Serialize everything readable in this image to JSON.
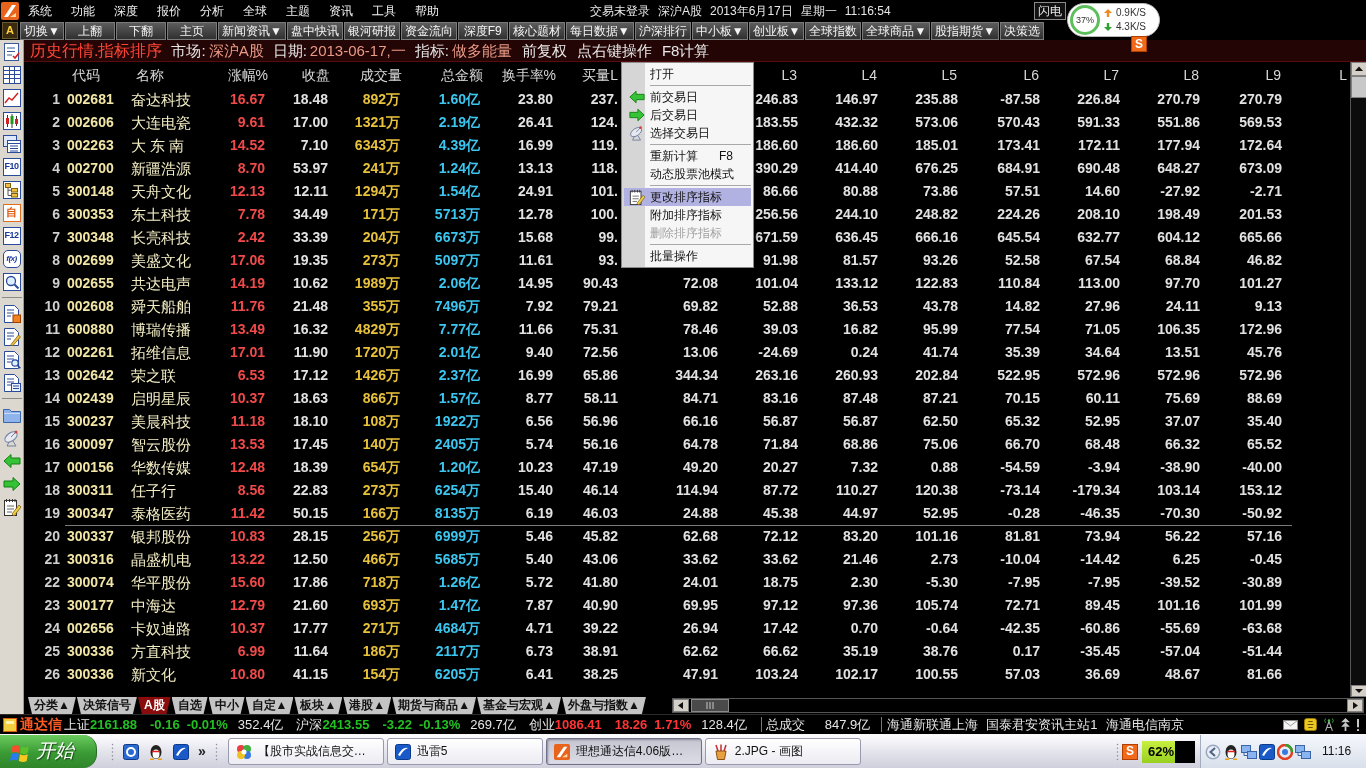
{
  "menu_bar": {
    "items": [
      "系统",
      "功能",
      "深度",
      "报价",
      "分析",
      "全球",
      "主题",
      "资讯",
      "工具",
      "帮助"
    ],
    "login_status": "交易未登录",
    "market": "深沪A股",
    "date": "2013年6月17日",
    "weekday": "星期一",
    "time": "11:16:54",
    "flash_button": "闪电"
  },
  "speed_widget": {
    "usage": "37%",
    "upload": "0.9K/S",
    "download": "4.3K/S"
  },
  "ime_toolbar": {
    "logo": "S"
  },
  "toolbar": {
    "lead": "A",
    "buttons": [
      "切换▼",
      "上翻",
      "下翻",
      "主页",
      "新闻资讯▼",
      "盘中快讯",
      "银河研报",
      "资金流向",
      "深度F9",
      "核心题材",
      "每日数据▼",
      "沪深排行",
      "中小板▼",
      "创业板▼",
      "全球指数",
      "全球商品▼",
      "股指期货▼",
      "决策选"
    ]
  },
  "sidebar": {
    "text_icons": [
      "F10",
      "自",
      "F12",
      "f(x)"
    ]
  },
  "title_bar": {
    "title": "历史行情.指标排序",
    "fields": [
      {
        "label": "市场:",
        "value": "深沪A股"
      },
      {
        "label": "日期:",
        "value": "2013-06-17,一"
      },
      {
        "label": "指标:",
        "value": "做多能量"
      }
    ],
    "notes": [
      "前复权",
      "点右键操作",
      "F8计算"
    ]
  },
  "table": {
    "columns": [
      null,
      "代码",
      "名称",
      "涨幅%",
      "收盘",
      "成交量",
      "总金额",
      "换手率%",
      "买量L",
      null,
      "L3",
      "L4",
      "L5",
      "L6",
      "L7",
      "L8",
      "L9",
      "L"
    ],
    "row_groups": [
      [
        {
          "cells": [
            "1",
            "002681",
            "奋达科技",
            "16.67",
            "18.48",
            "892万",
            "1.60亿",
            "23.80",
            "237.",
            null,
            "246.83",
            "146.97",
            "235.88",
            "-87.58",
            "226.84",
            "270.79",
            "270.79",
            null
          ]
        },
        {
          "cells": [
            "2",
            "002606",
            "大连电瓷",
            "9.61",
            "17.00",
            "1321万",
            "2.19亿",
            "26.41",
            "124.",
            null,
            "183.55",
            "432.32",
            "573.06",
            "570.43",
            "591.33",
            "551.86",
            "569.53",
            null
          ]
        },
        {
          "cells": [
            "3",
            "002263",
            "大 东 南",
            "14.52",
            "7.10",
            "6343万",
            "4.39亿",
            "16.99",
            "119.",
            null,
            "186.60",
            "186.60",
            "185.01",
            "173.41",
            "172.11",
            "177.94",
            "172.64",
            null
          ]
        },
        {
          "cells": [
            "4",
            "002700",
            "新疆浩源",
            "8.70",
            "53.97",
            "241万",
            "1.24亿",
            "13.13",
            "118.",
            null,
            "390.29",
            "414.40",
            "676.25",
            "684.91",
            "690.48",
            "648.27",
            "673.09",
            null
          ]
        },
        {
          "cells": [
            "5",
            "300148",
            "天舟文化",
            "12.13",
            "12.11",
            "1294万",
            "1.54亿",
            "24.91",
            "101.",
            null,
            "86.66",
            "80.88",
            "73.86",
            "57.51",
            "14.60",
            "-27.92",
            "-2.71",
            null
          ]
        },
        {
          "cells": [
            "6",
            "300353",
            "东土科技",
            "7.78",
            "34.49",
            "171万",
            "5713万",
            "12.78",
            "100.",
            null,
            "256.56",
            "244.10",
            "248.82",
            "224.26",
            "208.10",
            "198.49",
            "201.53",
            null
          ]
        },
        {
          "cells": [
            "7",
            "300348",
            "长亮科技",
            "2.42",
            "33.39",
            "204万",
            "6673万",
            "15.68",
            "99.",
            null,
            "671.59",
            "636.45",
            "666.16",
            "645.54",
            "632.77",
            "604.12",
            "665.66",
            null
          ]
        },
        {
          "cells": [
            "8",
            "002699",
            "美盛文化",
            "17.06",
            "19.35",
            "273万",
            "5097万",
            "11.61",
            "93.",
            null,
            "91.98",
            "81.57",
            "93.26",
            "52.58",
            "67.54",
            "68.84",
            "46.82",
            null
          ]
        },
        {
          "cells": [
            "9",
            "002655",
            "共达电声",
            "14.19",
            "10.62",
            "1989万",
            "2.06亿",
            "14.95",
            "90.43",
            "72.08",
            "101.04",
            "133.12",
            "122.83",
            "110.84",
            "113.00",
            "97.70",
            "101.27",
            null
          ]
        },
        {
          "cells": [
            "10",
            "002608",
            "舜天船舶",
            "11.76",
            "21.48",
            "355万",
            "7496万",
            "7.92",
            "79.21",
            "69.82",
            "52.88",
            "36.53",
            "43.78",
            "14.82",
            "27.96",
            "24.11",
            "9.13",
            null
          ]
        },
        {
          "cells": [
            "11",
            "600880",
            "博瑞传播",
            "13.49",
            "16.32",
            "4829万",
            "7.77亿",
            "11.66",
            "75.31",
            "78.46",
            "39.03",
            "16.82",
            "95.99",
            "77.54",
            "71.05",
            "106.35",
            "172.96",
            null
          ]
        },
        {
          "cells": [
            "12",
            "002261",
            "拓维信息",
            "17.01",
            "11.90",
            "1720万",
            "2.01亿",
            "9.40",
            "72.56",
            "13.06",
            "-24.69",
            "0.24",
            "41.74",
            "35.39",
            "34.64",
            "13.51",
            "45.76",
            null
          ]
        },
        {
          "cells": [
            "13",
            "002642",
            "荣之联",
            "6.53",
            "17.12",
            "1426万",
            "2.37亿",
            "16.99",
            "65.86",
            "344.34",
            "263.16",
            "260.93",
            "202.84",
            "522.95",
            "572.96",
            "572.96",
            "572.96",
            null
          ]
        },
        {
          "cells": [
            "14",
            "002439",
            "启明星辰",
            "10.37",
            "18.63",
            "866万",
            "1.57亿",
            "8.77",
            "58.11",
            "84.71",
            "83.16",
            "87.48",
            "87.21",
            "70.15",
            "60.11",
            "75.69",
            "88.69",
            null
          ]
        },
        {
          "cells": [
            "15",
            "300237",
            "美晨科技",
            "11.18",
            "18.10",
            "108万",
            "1922万",
            "6.56",
            "56.96",
            "66.16",
            "56.87",
            "56.87",
            "62.50",
            "65.32",
            "52.95",
            "37.07",
            "35.40",
            null
          ]
        },
        {
          "cells": [
            "16",
            "300097",
            "智云股份",
            "13.53",
            "17.45",
            "140万",
            "2405万",
            "5.74",
            "56.16",
            "64.78",
            "71.84",
            "68.86",
            "75.06",
            "66.70",
            "68.48",
            "66.32",
            "65.52",
            null
          ]
        },
        {
          "cells": [
            "17",
            "000156",
            "华数传媒",
            "12.48",
            "18.39",
            "654万",
            "1.20亿",
            "10.23",
            "47.19",
            "49.20",
            "20.27",
            "7.32",
            "0.88",
            "-54.59",
            "-3.94",
            "-38.90",
            "-40.00",
            null
          ]
        },
        {
          "cells": [
            "18",
            "300311",
            "任子行",
            "8.56",
            "22.83",
            "273万",
            "6254万",
            "15.40",
            "46.14",
            "114.94",
            "87.72",
            "110.27",
            "120.38",
            "-73.14",
            "-179.34",
            "103.14",
            "153.12",
            null
          ]
        },
        {
          "cells": [
            "19",
            "300347",
            "泰格医药",
            "11.42",
            "50.15",
            "166万",
            "8135万",
            "6.19",
            "46.03",
            "24.88",
            "45.38",
            "44.97",
            "52.95",
            "-0.28",
            "-46.35",
            "-70.30",
            "-50.92",
            null
          ]
        }
      ],
      [
        {
          "cells": [
            "20",
            "300337",
            "银邦股份",
            "10.83",
            "28.15",
            "256万",
            "6999万",
            "5.46",
            "45.82",
            "62.68",
            "72.12",
            "83.20",
            "101.16",
            "81.81",
            "73.94",
            "56.22",
            "57.16",
            null
          ]
        },
        {
          "cells": [
            "21",
            "300316",
            "晶盛机电",
            "13.22",
            "12.50",
            "466万",
            "5685万",
            "5.40",
            "43.06",
            "33.62",
            "33.62",
            "21.46",
            "2.73",
            "-10.04",
            "-14.42",
            "6.25",
            "-0.45",
            null
          ]
        },
        {
          "cells": [
            "22",
            "300074",
            "华平股份",
            "15.60",
            "17.86",
            "718万",
            "1.26亿",
            "5.72",
            "41.80",
            "24.01",
            "18.75",
            "2.30",
            "-5.30",
            "-7.95",
            "-7.95",
            "-39.52",
            "-30.89",
            null
          ]
        },
        {
          "cells": [
            "23",
            "300177",
            "中海达",
            "12.79",
            "21.60",
            "693万",
            "1.47亿",
            "7.87",
            "40.90",
            "69.95",
            "97.12",
            "97.36",
            "105.74",
            "72.71",
            "89.45",
            "101.16",
            "101.99",
            null
          ]
        },
        {
          "cells": [
            "24",
            "002656",
            "卡奴迪路",
            "10.37",
            "17.77",
            "271万",
            "4684万",
            "4.71",
            "39.22",
            "26.94",
            "17.42",
            "0.70",
            "-0.64",
            "-42.35",
            "-60.86",
            "-55.69",
            "-63.68",
            null
          ]
        },
        {
          "cells": [
            "25",
            "300336",
            "方直科技",
            "6.99",
            "11.64",
            "186万",
            "2117万",
            "6.73",
            "38.91",
            "62.62",
            "66.62",
            "35.19",
            "38.76",
            "0.17",
            "-35.45",
            "-57.04",
            "-51.44",
            null
          ]
        },
        {
          "cells": [
            "26",
            "300336",
            "新文化",
            "10.80",
            "41.15",
            "154万",
            "6205万",
            "6.41",
            "38.25",
            "47.91",
            "103.24",
            "102.17",
            "100.55",
            "57.03",
            "36.69",
            "48.67",
            "81.66",
            null
          ]
        }
      ]
    ]
  },
  "context_menu": {
    "items": [
      {
        "kind": "item",
        "label": "打开",
        "selected": false,
        "disabled": false
      },
      {
        "kind": "separator"
      },
      {
        "kind": "item",
        "label": "前交易日",
        "selected": false,
        "disabled": false
      },
      {
        "kind": "item",
        "label": "后交易日",
        "selected": false,
        "disabled": false
      },
      {
        "kind": "item",
        "label": "选择交易日",
        "selected": false,
        "disabled": false
      },
      {
        "kind": "separator"
      },
      {
        "kind": "item",
        "label": "重新计算",
        "shortcut": "F8",
        "selected": false,
        "disabled": false
      },
      {
        "kind": "item",
        "label": "动态股票池模式",
        "selected": false,
        "disabled": false
      },
      {
        "kind": "separator"
      },
      {
        "kind": "item",
        "label": "更改排序指标",
        "selected": true,
        "disabled": false
      },
      {
        "kind": "item",
        "label": "附加排序指标",
        "selected": false,
        "disabled": false
      },
      {
        "kind": "item",
        "label": "删除排序指标",
        "selected": false,
        "disabled": true
      },
      {
        "kind": "separator"
      },
      {
        "kind": "item",
        "label": "批量操作",
        "selected": false,
        "disabled": false
      }
    ]
  },
  "bottom_tabs": [
    {
      "label": "分类▲",
      "selected": false
    },
    {
      "label": "决策信号",
      "selected": false
    },
    {
      "label": "A股",
      "selected": true
    },
    {
      "label": "自选",
      "selected": false
    },
    {
      "label": "中小",
      "selected": false
    },
    {
      "label": "自定▲",
      "selected": false
    },
    {
      "label": "板块▲",
      "selected": false
    },
    {
      "label": "港股▲",
      "selected": false
    },
    {
      "label": "期货与商品▲",
      "selected": false
    },
    {
      "label": "基金与宏观▲",
      "selected": false
    },
    {
      "label": "外盘与指数▲",
      "selected": false
    }
  ],
  "status_bar": {
    "brand": "通达信",
    "indices": [
      {
        "name": "上证",
        "value": "2161.88",
        "change": "-0.16",
        "percent": "-0.01%",
        "amount": "352.4亿",
        "rising": false
      },
      {
        "name": "沪深",
        "value": "2413.55",
        "change": "-3.22",
        "percent": "-0.13%",
        "amount": "269.7亿",
        "rising": false
      },
      {
        "name": "创业",
        "value": "1086.41",
        "change": "18.26",
        "percent": "1.71%",
        "amount": "128.4亿",
        "rising": true
      }
    ],
    "total": {
      "label": "总成交",
      "value": "847.9亿"
    },
    "servers": [
      "海通新联通上海",
      "国泰君安资讯主站1",
      "海通电信南京"
    ]
  },
  "taskbar": {
    "start": "开始",
    "quick_launch_more": "»",
    "tasks": [
      {
        "label": "【股市实战信息交…",
        "selected": false
      },
      {
        "label": "迅雷5",
        "selected": false
      },
      {
        "label": "理想通达信4.06版…",
        "selected": true
      },
      {
        "label": "2.JPG - 画图",
        "selected": false
      }
    ],
    "ime_logo": "S",
    "meter": {
      "level": 0.62,
      "reading": "62%"
    },
    "clock": "11:16"
  }
}
